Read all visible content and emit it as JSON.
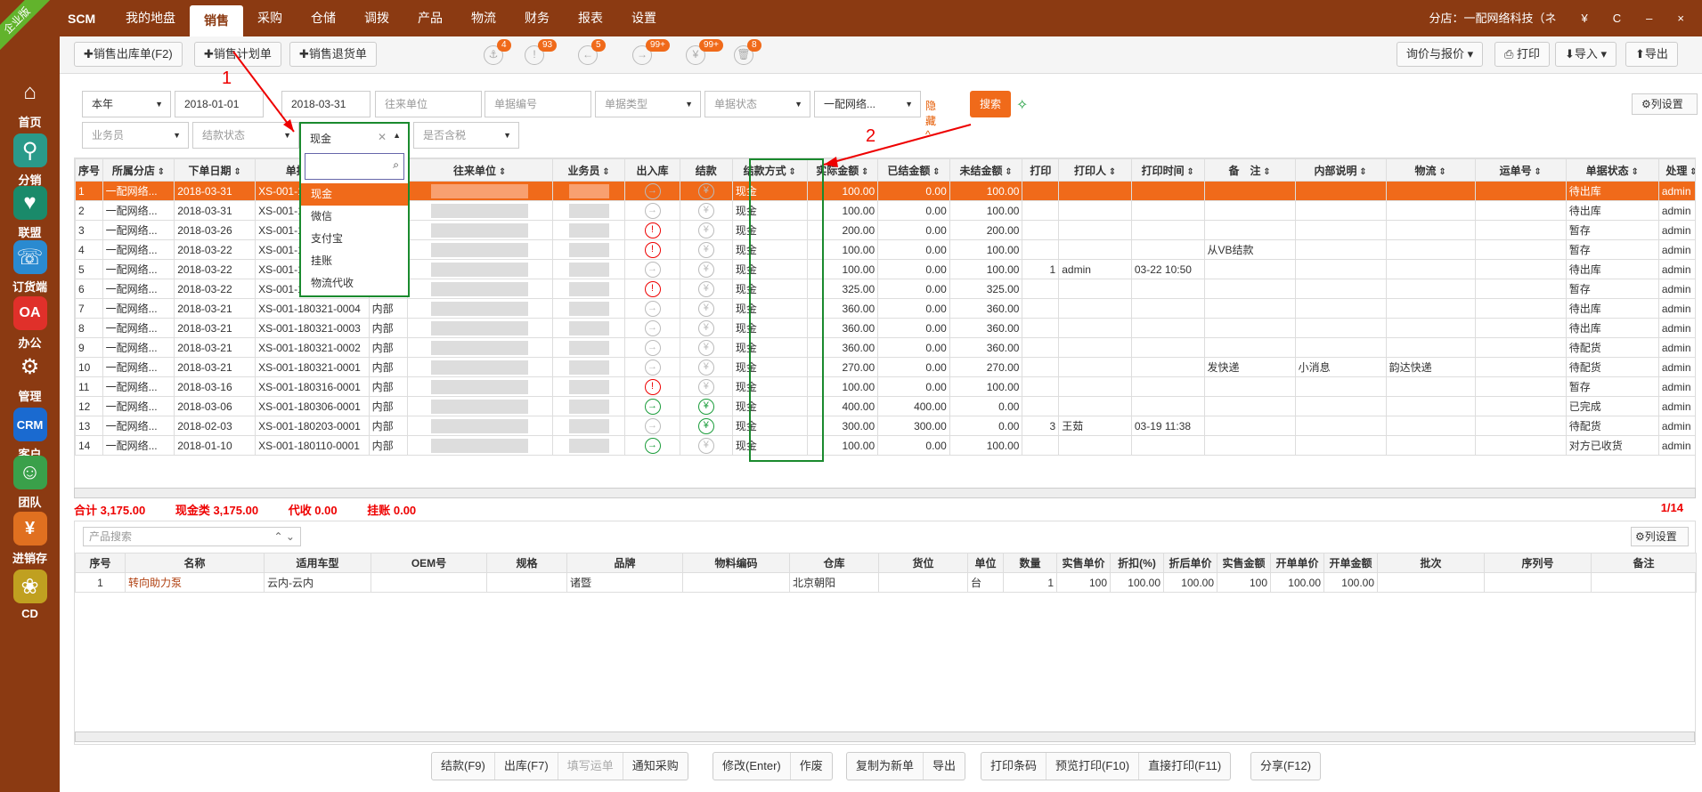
{
  "app": {
    "logo": "SCM",
    "edition_badge": "企业版"
  },
  "top_menu": [
    "我的地盘",
    "销售",
    "采购",
    "仓储",
    "调拨",
    "产品",
    "物流",
    "财务",
    "报表",
    "设置"
  ],
  "top_right": {
    "branch": "分店：一配网络科技（ネ",
    "currency": "¥",
    "refresh": "C",
    "minimize": "–",
    "close": "×"
  },
  "sidebar": [
    "首页",
    "分销",
    "联盟",
    "订货端",
    "办公",
    "管理",
    "客户",
    "团队",
    "进销存",
    "CD"
  ],
  "sidebar_icons": {
    "oa": "OA",
    "crm": "CRM",
    "yen": "¥"
  },
  "toolbar": {
    "btn1": "✚销售出库单(F2)",
    "btn2": "✚销售计划单",
    "btn3": "✚销售退货单",
    "badges": [
      "4",
      "93",
      "5",
      "99+",
      "99+",
      "8"
    ],
    "inquiry": "询价与报价 ▾",
    "print": "打印",
    "import": "导入 ▾",
    "export": "导出"
  },
  "filters": {
    "period": "本年",
    "date_from": "2018-01-01",
    "date_to": "2018-03-31",
    "partner_ph": "往来单位",
    "order_no_ph": "单据编号",
    "order_type": "单据类型",
    "order_status": "单据状态",
    "branch": "一配网络...",
    "hide": "隐藏^",
    "search": "搜索",
    "salesman": "业务员",
    "settle_status": "结款状态",
    "pay_method": "现金",
    "tax": "是否含税",
    "col_settings": "列设置"
  },
  "dropdown_options": [
    "现金",
    "微信",
    "支付宝",
    "挂账",
    "物流代收"
  ],
  "annotations": {
    "a1": "1",
    "a2": "2"
  },
  "headers": [
    "序号",
    "所属分店",
    "下单日期",
    "单据编号",
    "来源",
    "往来单位",
    "业务员",
    "出入库",
    "结款",
    "结款方式",
    "实际金额",
    "已结金额",
    "未结金额",
    "打印",
    "打印人",
    "打印时间",
    "备　注",
    "内部说明",
    "物流",
    "运单号",
    "单据状态",
    "处理"
  ],
  "rows": [
    {
      "n": "1",
      "br": "一配网络...",
      "d": "2018-03-31",
      "no": "XS-001-1",
      "src": "",
      "io": "n",
      "pay": "n",
      "pm": "现金",
      "amt": "100.00",
      "paid": "0.00",
      "unp": "100.00",
      "pr": "",
      "pp": "",
      "pt": "",
      "rm": "",
      "inn": "",
      "lg": "",
      "wb": "",
      "st": "待出库",
      "h": "admin"
    },
    {
      "n": "2",
      "br": "一配网络...",
      "d": "2018-03-31",
      "no": "XS-001-1",
      "src": "",
      "io": "n",
      "pay": "n",
      "pm": "现金",
      "amt": "100.00",
      "paid": "0.00",
      "unp": "100.00",
      "pr": "",
      "pp": "",
      "pt": "",
      "rm": "",
      "inn": "",
      "lg": "",
      "wb": "",
      "st": "待出库",
      "h": "admin"
    },
    {
      "n": "3",
      "br": "一配网络...",
      "d": "2018-03-26",
      "no": "XS-001-1",
      "src": "",
      "io": "r",
      "pay": "n",
      "pm": "现金",
      "amt": "200.00",
      "paid": "0.00",
      "unp": "200.00",
      "pr": "",
      "pp": "",
      "pt": "",
      "rm": "",
      "inn": "",
      "lg": "",
      "wb": "",
      "st": "暂存",
      "h": "admin"
    },
    {
      "n": "4",
      "br": "一配网络...",
      "d": "2018-03-22",
      "no": "XS-001-1",
      "src": "",
      "io": "r",
      "pay": "n",
      "pm": "现金",
      "amt": "100.00",
      "paid": "0.00",
      "unp": "100.00",
      "pr": "",
      "pp": "",
      "pt": "",
      "rm": "从VB结款",
      "inn": "",
      "lg": "",
      "wb": "",
      "st": "暂存",
      "h": "admin"
    },
    {
      "n": "5",
      "br": "一配网络...",
      "d": "2018-03-22",
      "no": "XS-001-1",
      "src": "",
      "io": "n",
      "pay": "n",
      "pm": "现金",
      "amt": "100.00",
      "paid": "0.00",
      "unp": "100.00",
      "pr": "1",
      "pp": "admin",
      "pt": "03-22 10:50",
      "rm": "",
      "inn": "",
      "lg": "",
      "wb": "",
      "st": "待出库",
      "h": "admin"
    },
    {
      "n": "6",
      "br": "一配网络...",
      "d": "2018-03-22",
      "no": "XS-001-1",
      "src": "",
      "io": "r",
      "pay": "n",
      "pm": "现金",
      "amt": "325.00",
      "paid": "0.00",
      "unp": "325.00",
      "pr": "",
      "pp": "",
      "pt": "",
      "rm": "",
      "inn": "",
      "lg": "",
      "wb": "",
      "st": "暂存",
      "h": "admin"
    },
    {
      "n": "7",
      "br": "一配网络...",
      "d": "2018-03-21",
      "no": "XS-001-180321-0004",
      "src": "内部",
      "io": "n",
      "pay": "n",
      "pm": "现金",
      "amt": "360.00",
      "paid": "0.00",
      "unp": "360.00",
      "pr": "",
      "pp": "",
      "pt": "",
      "rm": "",
      "inn": "",
      "lg": "",
      "wb": "",
      "st": "待出库",
      "h": "admin"
    },
    {
      "n": "8",
      "br": "一配网络...",
      "d": "2018-03-21",
      "no": "XS-001-180321-0003",
      "src": "内部",
      "io": "n",
      "pay": "n",
      "pm": "现金",
      "amt": "360.00",
      "paid": "0.00",
      "unp": "360.00",
      "pr": "",
      "pp": "",
      "pt": "",
      "rm": "",
      "inn": "",
      "lg": "",
      "wb": "",
      "st": "待出库",
      "h": "admin"
    },
    {
      "n": "9",
      "br": "一配网络...",
      "d": "2018-03-21",
      "no": "XS-001-180321-0002",
      "src": "内部",
      "io": "n",
      "pay": "n",
      "pm": "现金",
      "amt": "360.00",
      "paid": "0.00",
      "unp": "360.00",
      "pr": "",
      "pp": "",
      "pt": "",
      "rm": "",
      "inn": "",
      "lg": "",
      "wb": "",
      "st": "待配货",
      "h": "admin"
    },
    {
      "n": "10",
      "br": "一配网络...",
      "d": "2018-03-21",
      "no": "XS-001-180321-0001",
      "src": "内部",
      "io": "n",
      "pay": "n",
      "pm": "现金",
      "amt": "270.00",
      "paid": "0.00",
      "unp": "270.00",
      "pr": "",
      "pp": "",
      "pt": "",
      "rm": "发快递",
      "inn": "小消息",
      "lg": "韵达快递",
      "wb": "",
      "st": "待配货",
      "h": "admin"
    },
    {
      "n": "11",
      "br": "一配网络...",
      "d": "2018-03-16",
      "no": "XS-001-180316-0001",
      "src": "内部",
      "io": "r",
      "pay": "n",
      "pm": "现金",
      "amt": "100.00",
      "paid": "0.00",
      "unp": "100.00",
      "pr": "",
      "pp": "",
      "pt": "",
      "rm": "",
      "inn": "",
      "lg": "",
      "wb": "",
      "st": "暂存",
      "h": "admin"
    },
    {
      "n": "12",
      "br": "一配网络...",
      "d": "2018-03-06",
      "no": "XS-001-180306-0001",
      "src": "内部",
      "io": "g",
      "pay": "g",
      "pm": "现金",
      "amt": "400.00",
      "paid": "400.00",
      "unp": "0.00",
      "pr": "",
      "pp": "",
      "pt": "",
      "rm": "",
      "inn": "",
      "lg": "",
      "wb": "",
      "st": "已完成",
      "h": "admin"
    },
    {
      "n": "13",
      "br": "一配网络...",
      "d": "2018-02-03",
      "no": "XS-001-180203-0001",
      "src": "内部",
      "io": "n",
      "pay": "g",
      "pm": "现金",
      "amt": "300.00",
      "paid": "300.00",
      "unp": "0.00",
      "pr": "3",
      "pp": "王茹",
      "pt": "03-19 11:38",
      "rm": "",
      "inn": "",
      "lg": "",
      "wb": "",
      "st": "待配货",
      "h": "admin"
    },
    {
      "n": "14",
      "br": "一配网络...",
      "d": "2018-01-10",
      "no": "XS-001-180110-0001",
      "src": "内部",
      "io": "g",
      "pay": "n",
      "pm": "现金",
      "amt": "100.00",
      "paid": "0.00",
      "unp": "100.00",
      "pr": "",
      "pp": "",
      "pt": "",
      "rm": "",
      "inn": "",
      "lg": "",
      "wb": "",
      "st": "对方已收货",
      "h": "admin"
    }
  ],
  "summary": {
    "total": "合计 3,175.00",
    "cash": "现金类 3,175.00",
    "cod": "代收 0.00",
    "credit": "挂账 0.00",
    "page": "1/14"
  },
  "product_search_ph": "产品搜索",
  "detail_headers": [
    "序号",
    "名称",
    "适用车型",
    "OEM号",
    "规格",
    "品牌",
    "物料编码",
    "仓库",
    "货位",
    "单位",
    "数量",
    "实售单价",
    "折扣(%)",
    "折后单价",
    "实售金额",
    "开单单价",
    "开单金额",
    "批次",
    "序列号",
    "备注"
  ],
  "detail_row": [
    "1",
    "转向助力泵",
    "云内-云内",
    "",
    "",
    "诸暨",
    "",
    "北京朝阳",
    "",
    "台",
    "1",
    "100",
    "100.00",
    "100.00",
    "100",
    "100.00",
    "100.00",
    "",
    "",
    ""
  ],
  "bottom_group1": [
    "结款(F9)",
    "出库(F7)",
    "填写运单",
    "通知采购"
  ],
  "bottom_group2": [
    "修改(Enter)",
    "作废"
  ],
  "bottom_group3": [
    "复制为新单",
    "导出"
  ],
  "bottom_group4": [
    "打印条码",
    "预览打印(F10)",
    "直接打印(F11)"
  ],
  "bottom_group5": [
    "分享(F12)"
  ]
}
